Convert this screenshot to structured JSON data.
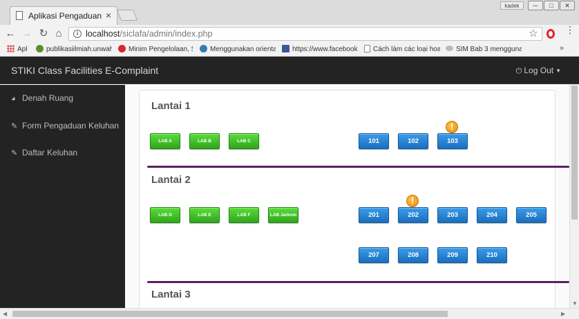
{
  "browser": {
    "tab_title": "Aplikasi Pengaduan",
    "tab_close": "×",
    "profile_label": "kadek",
    "url_host": "localhost",
    "url_path": "/siclafa/admin/index.php",
    "bookmarks": [
      {
        "label": "Apl",
        "icon": "apps-icon"
      },
      {
        "label": "publikasiilmiah.unwah",
        "icon": "globe-icon",
        "color": "#5a8f2e"
      },
      {
        "label": "Minim Pengelolaan, S",
        "icon": "site-icon",
        "color": "#d8262d"
      },
      {
        "label": "Menggunakan orienta",
        "icon": "wordpress-icon",
        "color": "#2f7db4"
      },
      {
        "label": "https://www.facebook",
        "icon": "facebook-icon",
        "color": "#3b5998"
      },
      {
        "label": "Cách làm các loại hoa",
        "icon": "page-icon",
        "color": "#888888"
      },
      {
        "label": "SIM Bab 3 mengguna",
        "icon": "cloud-icon",
        "color": "#999999"
      }
    ],
    "bookmarks_more": "»"
  },
  "header": {
    "brand": "STIKI Class Facilities E-Complaint",
    "logout_label": "Log Out"
  },
  "sidebar": {
    "items": [
      {
        "label": "Denah Ruang",
        "icon": "dashboard-icon"
      },
      {
        "label": "Form Pengaduan Keluhan",
        "icon": "edit-icon"
      },
      {
        "label": "Daftar Keluhan",
        "icon": "edit-icon"
      }
    ]
  },
  "floors": [
    {
      "title": "Lantai 1",
      "labs": [
        "LAB A",
        "LAB B",
        "LAB C"
      ],
      "rooms": [
        "101",
        "102",
        "103"
      ],
      "alerts": [
        "103"
      ]
    },
    {
      "title": "Lantai 2",
      "labs": [
        "LAB D",
        "LAB E",
        "LAB F",
        "LAB Jarkom"
      ],
      "rooms": [
        "201",
        "202",
        "203",
        "204",
        "205",
        "207",
        "208",
        "209",
        "210"
      ],
      "alerts": [
        "202"
      ]
    },
    {
      "title": "Lantai 3"
    }
  ],
  "alert_symbol": "!",
  "colors": {
    "lab_button": "#34b41f",
    "room_button": "#1f7acb",
    "alert": "#f39c12",
    "divider": "#5a1f5e",
    "header_bg": "#232323"
  }
}
